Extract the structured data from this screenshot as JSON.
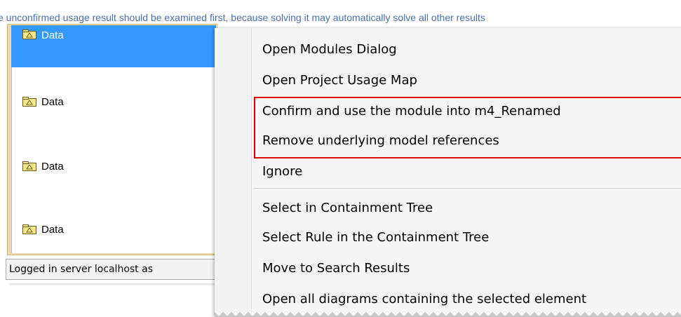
{
  "top_text": "e unconfirmed usage result should be examined first, because solving it may automatically solve all other results",
  "tree": {
    "items": [
      {
        "label": "Data",
        "selected": true
      },
      {
        "label": "Data",
        "selected": false
      },
      {
        "label": "Data",
        "selected": false
      },
      {
        "label": "Data",
        "selected": false
      }
    ]
  },
  "status_bar": {
    "text": "Logged in server localhost as"
  },
  "context_menu": {
    "items": [
      {
        "label": "Open Modules Dialog"
      },
      {
        "label": "Open Project Usage Map"
      },
      {
        "label": "Confirm and use the module into m4_Renamed"
      },
      {
        "label": "Remove underlying model references"
      },
      {
        "label": "Ignore"
      },
      {
        "label": "Select in Containment Tree"
      },
      {
        "label": "Select Rule in the Containment Tree"
      },
      {
        "label": "Move to Search Results"
      },
      {
        "label": "Open all diagrams containing the selected element"
      }
    ]
  },
  "colors": {
    "selection": "#3399ff",
    "highlight_border": "#e00000",
    "panel_border": "#f0d9a8",
    "top_text": "#4a6fa5"
  }
}
